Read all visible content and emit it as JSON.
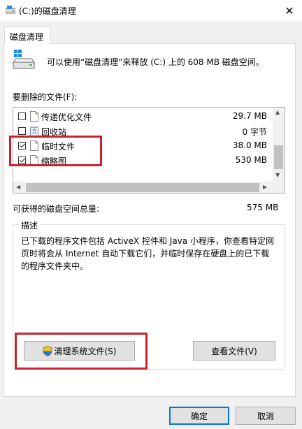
{
  "window": {
    "title": "(C:)的磁盘清理",
    "close_glyph": "✕"
  },
  "tab": {
    "label": "磁盘清理"
  },
  "summary": {
    "text": "可以使用“磁盘清理”来释放 (C:) 上的 608 MB 磁盘空间。"
  },
  "files_label": "要删除的文件(F):",
  "files": [
    {
      "name": "传递优化文件",
      "size": "29.7 MB",
      "checked": false,
      "icon": "file-icon"
    },
    {
      "name": "回收站",
      "size": "0 字节",
      "checked": false,
      "icon": "recycle-bin-icon"
    },
    {
      "name": "临时文件",
      "size": "38.0 MB",
      "checked": true,
      "icon": "file-icon"
    },
    {
      "name": "缩略图",
      "size": "530 MB",
      "checked": true,
      "icon": "file-icon"
    }
  ],
  "total": {
    "label": "可获得的磁盘空间总量:",
    "value": "575 MB"
  },
  "description": {
    "title": "描述",
    "text": "已下载的程序文件包括 ActiveX 控件和 Java 小程序，你查看特定网页时将会从 Internet 自动下载它们，并临时保存在硬盘上的已下载的程序文件夹中。"
  },
  "buttons": {
    "cleanup_system": "清理系统文件(S)",
    "view_files": "查看文件(V)",
    "ok": "确定",
    "cancel": "取消"
  },
  "colors": {
    "highlight": "#c8232c",
    "accent": "#0078d7",
    "scrollbar_thumb": "#c1c1c1"
  }
}
